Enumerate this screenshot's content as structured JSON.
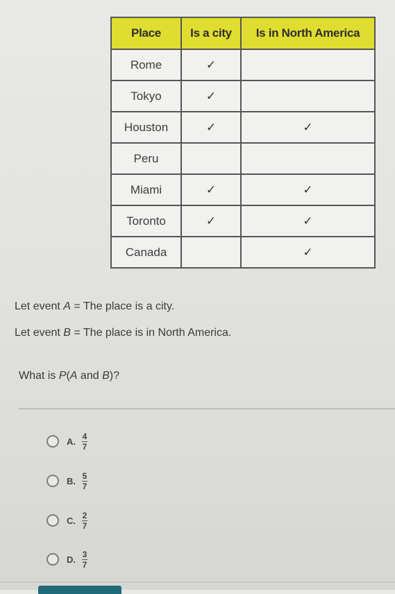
{
  "table": {
    "headers": [
      "Place",
      "Is a city",
      "Is in North America"
    ],
    "rows": [
      {
        "place": "Rome",
        "city": "✓",
        "na": ""
      },
      {
        "place": "Tokyo",
        "city": "✓",
        "na": ""
      },
      {
        "place": "Houston",
        "city": "✓",
        "na": "✓"
      },
      {
        "place": "Peru",
        "city": "",
        "na": ""
      },
      {
        "place": "Miami",
        "city": "✓",
        "na": "✓"
      },
      {
        "place": "Toronto",
        "city": "✓",
        "na": "✓"
      },
      {
        "place": "Canada",
        "city": "",
        "na": "✓"
      }
    ],
    "header_color": "#dfdd2f"
  },
  "events": {
    "a_prefix": "Let event ",
    "a_var": "A",
    "a_rest": " = The place is a city.",
    "b_prefix": "Let event ",
    "b_var": "B",
    "b_rest": " = The place is in North America."
  },
  "question": {
    "prefix": "What is ",
    "p": "P",
    "open": "(",
    "a": "A",
    "and": " and ",
    "b": "B",
    "close": ")?"
  },
  "options": [
    {
      "letter": "A.",
      "numerator": "4",
      "denominator": "7"
    },
    {
      "letter": "B.",
      "numerator": "5",
      "denominator": "7"
    },
    {
      "letter": "C.",
      "numerator": "2",
      "denominator": "7"
    },
    {
      "letter": "D.",
      "numerator": "3",
      "denominator": "7"
    }
  ],
  "accent_color": "#1f6b7a"
}
